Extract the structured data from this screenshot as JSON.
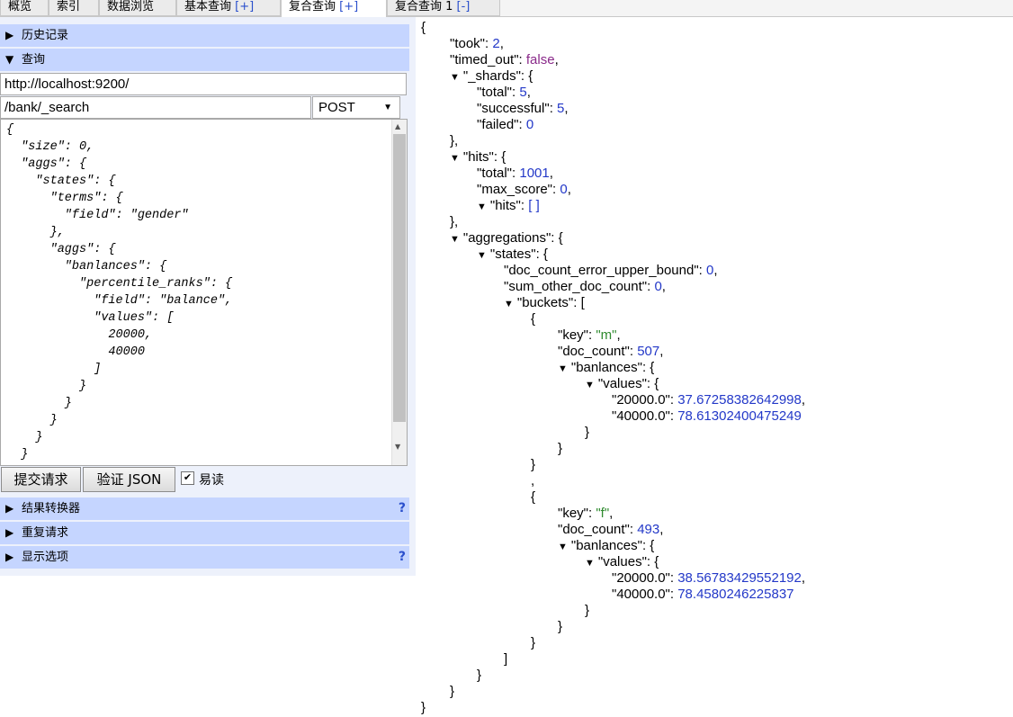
{
  "tabs": [
    {
      "label": "概览"
    },
    {
      "label": "索引"
    },
    {
      "label": "数据浏览"
    },
    {
      "label": "基本查询",
      "suffix": "[+]"
    },
    {
      "label": "复合查询",
      "suffix": "[+]"
    },
    {
      "label": "复合查询 1",
      "suffix": "[-]"
    }
  ],
  "left": {
    "history_label": "历史记录",
    "query_label": "查询",
    "url_value": "http://localhost:9200/",
    "path_value": "/bank/_search",
    "method_value": "POST",
    "body_text": "{\n  \"size\": 0,\n  \"aggs\": {\n    \"states\": {\n      \"terms\": {\n        \"field\": \"gender\"\n      },\n      \"aggs\": {\n        \"banlances\": {\n          \"percentile_ranks\": {\n            \"field\": \"balance\",\n            \"values\": [\n              20000,\n              40000\n            ]\n          }\n        }\n      }\n    }\n  }\n}",
    "submit_label": "提交请求",
    "validate_label": "验证 JSON",
    "pretty_label": "易读",
    "pretty_checked": true,
    "transformer_label": "结果转换器",
    "repeat_label": "重复请求",
    "display_label": "显示选项",
    "help_glyph": "?"
  },
  "icons": {
    "collapsed": "triangle-right-icon",
    "expanded": "triangle-down-icon"
  },
  "result": {
    "open_brace": "{",
    "took_key": "\"took\"",
    "took": "2",
    "timed_out_key": "\"timed_out\"",
    "timed_out": "false",
    "shards_key": "\"_shards\"",
    "shards_total_key": "\"total\"",
    "shards_total": "5",
    "shards_successful_key": "\"successful\"",
    "shards_successful": "5",
    "shards_failed_key": "\"failed\"",
    "shards_failed": "0",
    "hits_key": "\"hits\"",
    "hits_total_key": "\"total\"",
    "hits_total": "1001",
    "max_score_key": "\"max_score\"",
    "max_score": "0",
    "hits_hits_key": "\"hits\"",
    "hits_hits": "[ ]",
    "aggregations_key": "\"aggregations\"",
    "states_key": "\"states\"",
    "doc_count_error_key": "\"doc_count_error_upper_bound\"",
    "doc_count_error": "0",
    "sum_other_key": "\"sum_other_doc_count\"",
    "sum_other": "0",
    "buckets_key": "\"buckets\"",
    "bucket1": {
      "key_key": "\"key\"",
      "key": "\"m\"",
      "doc_count_key": "\"doc_count\"",
      "doc_count": "507",
      "banlances_key": "\"banlances\"",
      "values_key": "\"values\"",
      "v20000_key": "\"20000.0\"",
      "v20000": "37.67258382642998",
      "v40000_key": "\"40000.0\"",
      "v40000": "78.61302400475249"
    },
    "bucket2": {
      "key_key": "\"key\"",
      "key": "\"f\"",
      "doc_count_key": "\"doc_count\"",
      "doc_count": "493",
      "banlances_key": "\"banlances\"",
      "values_key": "\"values\"",
      "v20000_key": "\"20000.0\"",
      "v20000": "38.56783429552192",
      "v40000_key": "\"40000.0\"",
      "v40000": "78.4580246225837"
    }
  }
}
